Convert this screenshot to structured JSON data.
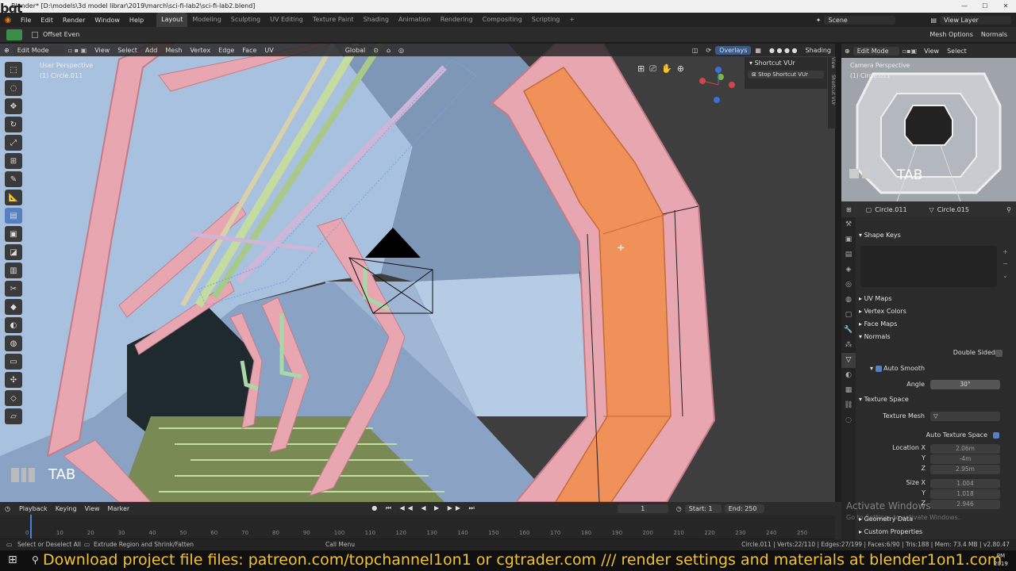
{
  "window": {
    "title": "Blender* [D:\\models\\3d model librar\\2019\\march\\sci-fi-lab2\\sci-fi-lab2.blend]",
    "overlay_logo": "bgt"
  },
  "menus": [
    "File",
    "Edit",
    "Render",
    "Window",
    "Help"
  ],
  "workspaces": [
    "Layout",
    "Modeling",
    "Sculpting",
    "UV Editing",
    "Texture Paint",
    "Shading",
    "Animation",
    "Rendering",
    "Compositing",
    "Scripting"
  ],
  "active_workspace": "Layout",
  "scene": {
    "label": "Scene",
    "view_layer": "View Layer"
  },
  "tool_header": {
    "offset_even": "Offset Even",
    "mesh_options": "Mesh Options",
    "normals": "Normals"
  },
  "viewport": {
    "mode": "Edit Mode",
    "menus": [
      "View",
      "Select",
      "Add",
      "Mesh",
      "Vertex",
      "Edge",
      "Face",
      "UV"
    ],
    "orientation": "Global",
    "overlays": "Overlays",
    "shading": "Shading",
    "perspective": "User Perspective",
    "object": "(1) Circle.011",
    "key_hint": "TAB"
  },
  "shortcut_panel": {
    "title": "Shortcut VUr",
    "button": "Stop Shortcut VUr",
    "side_tabs": [
      "View",
      "Shortcut VUr"
    ]
  },
  "camera_view": {
    "mode": "Edit Mode",
    "menus": [
      "View",
      "Select"
    ],
    "perspective": "Camera Perspective",
    "object": "(1) Circle.011",
    "key_hint": "TAB"
  },
  "properties": {
    "object_name": "Circle.011",
    "mesh_name": "Circle.015",
    "sections": {
      "shape_keys": "Shape Keys",
      "uv_maps": "UV Maps",
      "vertex_colors": "Vertex Colors",
      "face_maps": "Face Maps",
      "normals": "Normals",
      "texture_space": "Texture Space",
      "geometry_data": "Geometry Data",
      "custom_properties": "Custom Properties"
    },
    "double_sided": "Double Sided",
    "auto_smooth": "Auto Smooth",
    "angle_label": "Angle",
    "angle_value": "30°",
    "texture_mesh": "Texture Mesh",
    "auto_texture_space": "Auto Texture Space",
    "location": {
      "label_x": "Location X",
      "label_y": "Y",
      "label_z": "Z",
      "x": "2.06m",
      "y": "-4m",
      "z": "2.95m"
    },
    "size": {
      "label_x": "Size X",
      "label_y": "Y",
      "label_z": "Z",
      "x": "1.004",
      "y": "1.018",
      "z": "2.946"
    }
  },
  "activate_windows": {
    "title": "Activate Windows",
    "subtitle": "Go to Settings to activate Windows."
  },
  "timeline": {
    "menus": [
      "Playback",
      "Keying",
      "View",
      "Marker"
    ],
    "current_frame": "1",
    "start_label": "Start:",
    "start": "1",
    "end_label": "End:",
    "end": "250",
    "ticks": [
      "0",
      "10",
      "20",
      "30",
      "40",
      "50",
      "60",
      "70",
      "80",
      "90",
      "100",
      "110",
      "120",
      "130",
      "140",
      "150",
      "160",
      "170",
      "180",
      "190",
      "200",
      "210",
      "220",
      "230",
      "240",
      "250"
    ]
  },
  "status": {
    "select": "Select or Deselect All",
    "extrude": "Extrude Region and Shrink/Fatten",
    "call_menu": "Call Menu",
    "stats": "Circle.011 | Verts:22/110 | Edges:27/199 | Faces:6/90 | Tris:188 | Mem: 73.4 MB | v2.80.47"
  },
  "taskbar": {
    "time": "PM",
    "year": "2019"
  },
  "banner": "Download project file files: patreon.com/topchannel1on1 or cgtrader.com  /// render settings and materials at blender1on1.com",
  "colors": {
    "frame_pink": "#e8a6b0",
    "selected_orange": "#f0915a",
    "wall_blue": "#9db9d8",
    "pipe_green": "#c4dca0",
    "banner_yellow": "#f2c230",
    "accent_blue": "#5680c2"
  }
}
